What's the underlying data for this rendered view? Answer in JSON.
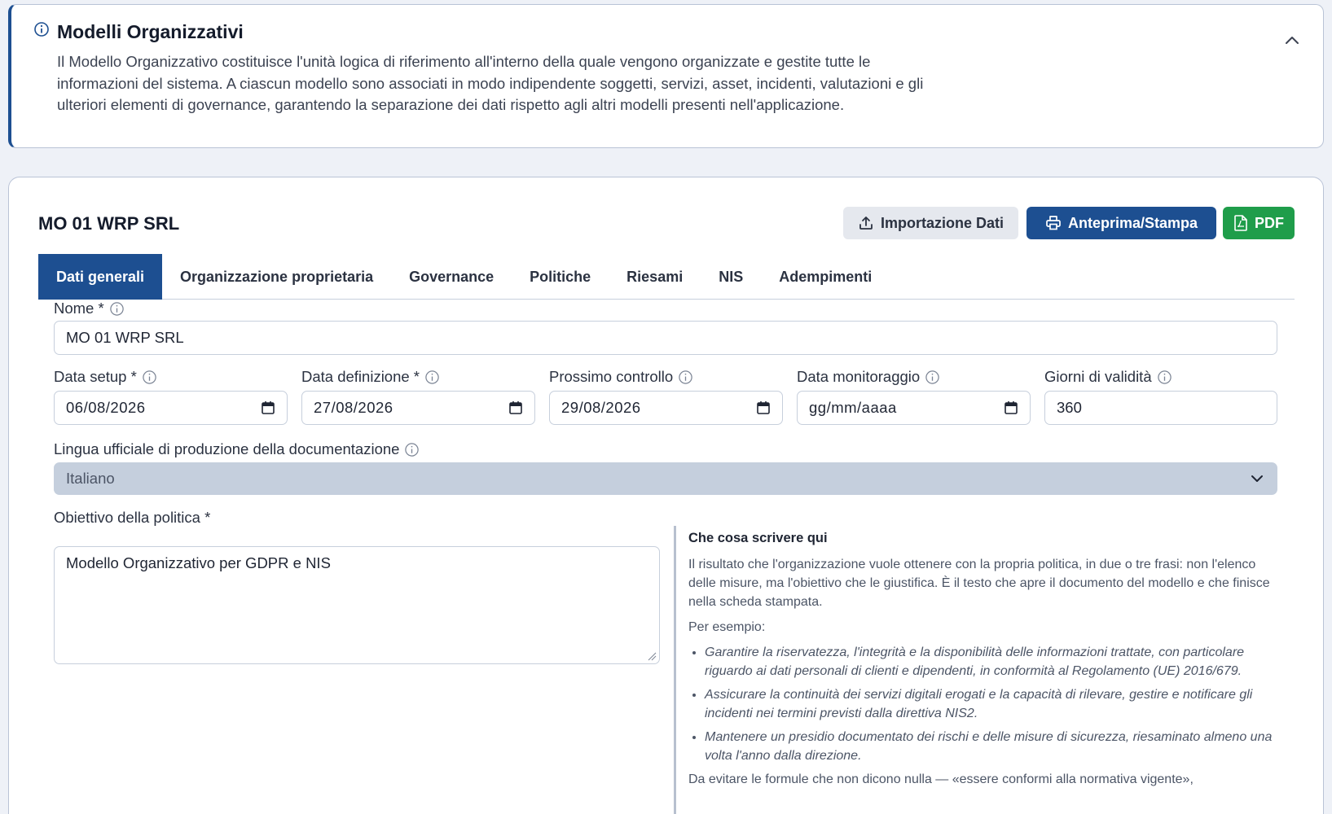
{
  "banner": {
    "title": "Modelli Organizzativi",
    "text": "Il Modello Organizzativo costituisce l'unità logica di riferimento all'interno della quale vengono organizzate e gestite tutte le informazioni del sistema. A ciascun modello sono associati in modo indipendente soggetti, servizi, asset, incidenti, valutazioni e gli ulteriori elementi di governance, garantendo la separazione dei dati rispetto agli altri modelli presenti nell'applicazione.",
    "icon": "info-icon",
    "collapse_icon": "chevron-up-icon"
  },
  "record": {
    "title": "MO 01 WRP SRL"
  },
  "toolbar": {
    "import_label": "Importazione Dati",
    "print_label": "Anteprima/Stampa",
    "pdf_label": "PDF",
    "colors": {
      "primary": "#1d4f91",
      "pdf": "#1f9d4a",
      "secondary": "#e5e8ee"
    }
  },
  "tabs": [
    {
      "label": "Dati generali",
      "active": true
    },
    {
      "label": "Organizzazione proprietaria",
      "active": false
    },
    {
      "label": "Governance",
      "active": false
    },
    {
      "label": "Politiche",
      "active": false
    },
    {
      "label": "Riesami",
      "active": false
    },
    {
      "label": "NIS",
      "active": false
    },
    {
      "label": "Adempimenti",
      "active": false
    }
  ],
  "form": {
    "nome": {
      "label": "Nome *",
      "value": "MO 01 WRP SRL"
    },
    "data_setup": {
      "label": "Data setup *",
      "value": "06/08/2026"
    },
    "data_definizione": {
      "label": "Data definizione *",
      "value": "27/08/2026"
    },
    "prossimo_controllo": {
      "label": "Prossimo controllo",
      "value": "29/08/2026"
    },
    "data_monitoraggio": {
      "label": "Data monitoraggio",
      "value": "gg/mm/aaaa"
    },
    "giorni_validita": {
      "label": "Giorni di validità",
      "value": "360"
    },
    "lingua": {
      "label": "Lingua ufficiale di produzione della documentazione",
      "value": "Italiano"
    },
    "obiettivo": {
      "label": "Obiettivo della politica *",
      "value": "Modello Organizzativo per GDPR e NIS"
    }
  },
  "help": {
    "title": "Che cosa scrivere qui",
    "intro": "Il risultato che l'organizzazione vuole ottenere con la propria politica, in due o tre frasi: non l'elenco delle misure, ma l'obiettivo che le giustifica. È il testo che apre il documento del modello e che finisce nella scheda stampata.",
    "example_label": "Per esempio:",
    "examples": [
      "Garantire la riservatezza, l'integrità e la disponibilità delle informazioni trattate, con particolare riguardo ai dati personali di clienti e dipendenti, in conformità al Regolamento (UE) 2016/679.",
      "Assicurare la continuità dei servizi digitali erogati e la capacità di rilevare, gestire e notificare gli incidenti nei termini previsti dalla direttiva NIS2.",
      "Mantenere un presidio documentato dei rischi e delle misure di sicurezza, riesaminato almeno una volta l'anno dalla direzione."
    ],
    "avoid": "Da evitare le formule che non dicono nulla — «essere conformi alla normativa vigente»,"
  }
}
